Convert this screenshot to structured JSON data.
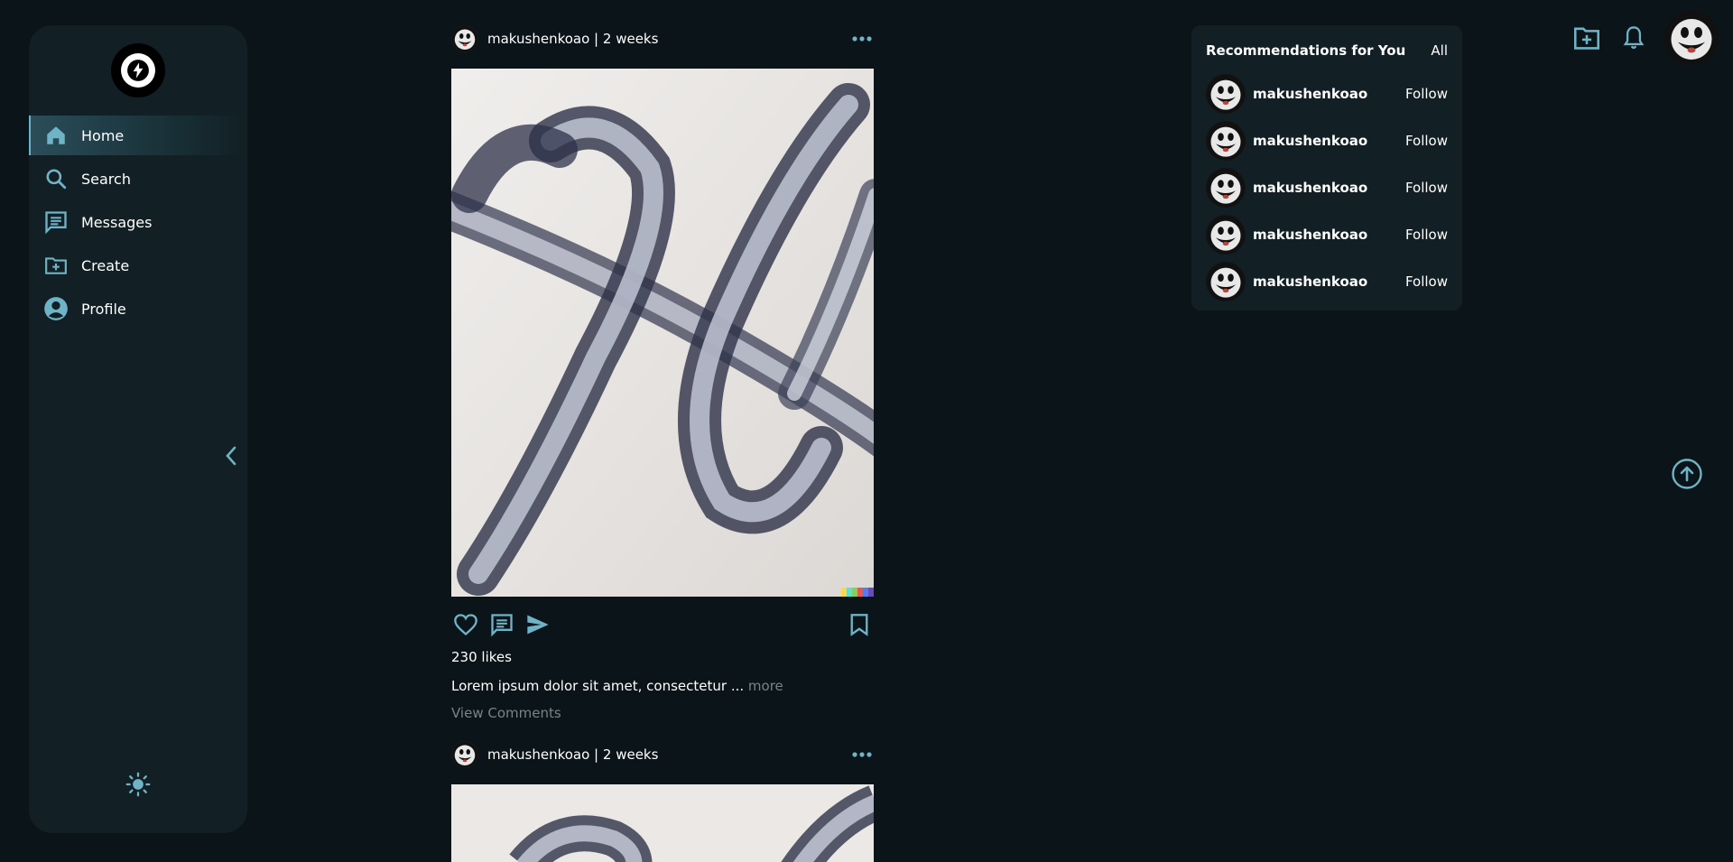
{
  "nav": {
    "items": [
      {
        "label": "Home",
        "icon": "home-icon",
        "active": true
      },
      {
        "label": "Search",
        "icon": "search-icon"
      },
      {
        "label": "Messages",
        "icon": "messages-icon"
      },
      {
        "label": "Create",
        "icon": "create-folder-icon"
      },
      {
        "label": "Profile",
        "icon": "profile-icon"
      }
    ]
  },
  "posts": [
    {
      "author": "makushenkoao | 2 weeks",
      "likes": "230 likes",
      "caption": "Lorem ipsum dolor sit amet, consectetur ...",
      "more": "more",
      "view_comments": "View Comments"
    },
    {
      "author": "makushenkoao | 2 weeks"
    }
  ],
  "recommendations": {
    "title": "Recommendations for You",
    "all_label": "All",
    "items": [
      {
        "name": "makushenkoao",
        "follow": "Follow"
      },
      {
        "name": "makushenkoao",
        "follow": "Follow"
      },
      {
        "name": "makushenkoao",
        "follow": "Follow"
      },
      {
        "name": "makushenkoao",
        "follow": "Follow"
      },
      {
        "name": "makushenkoao",
        "follow": "Follow"
      }
    ]
  },
  "colors": {
    "background": "#0b1418",
    "panel": "#121f24",
    "accent": "#6fb3c6",
    "muted_text": "#7a8387"
  }
}
